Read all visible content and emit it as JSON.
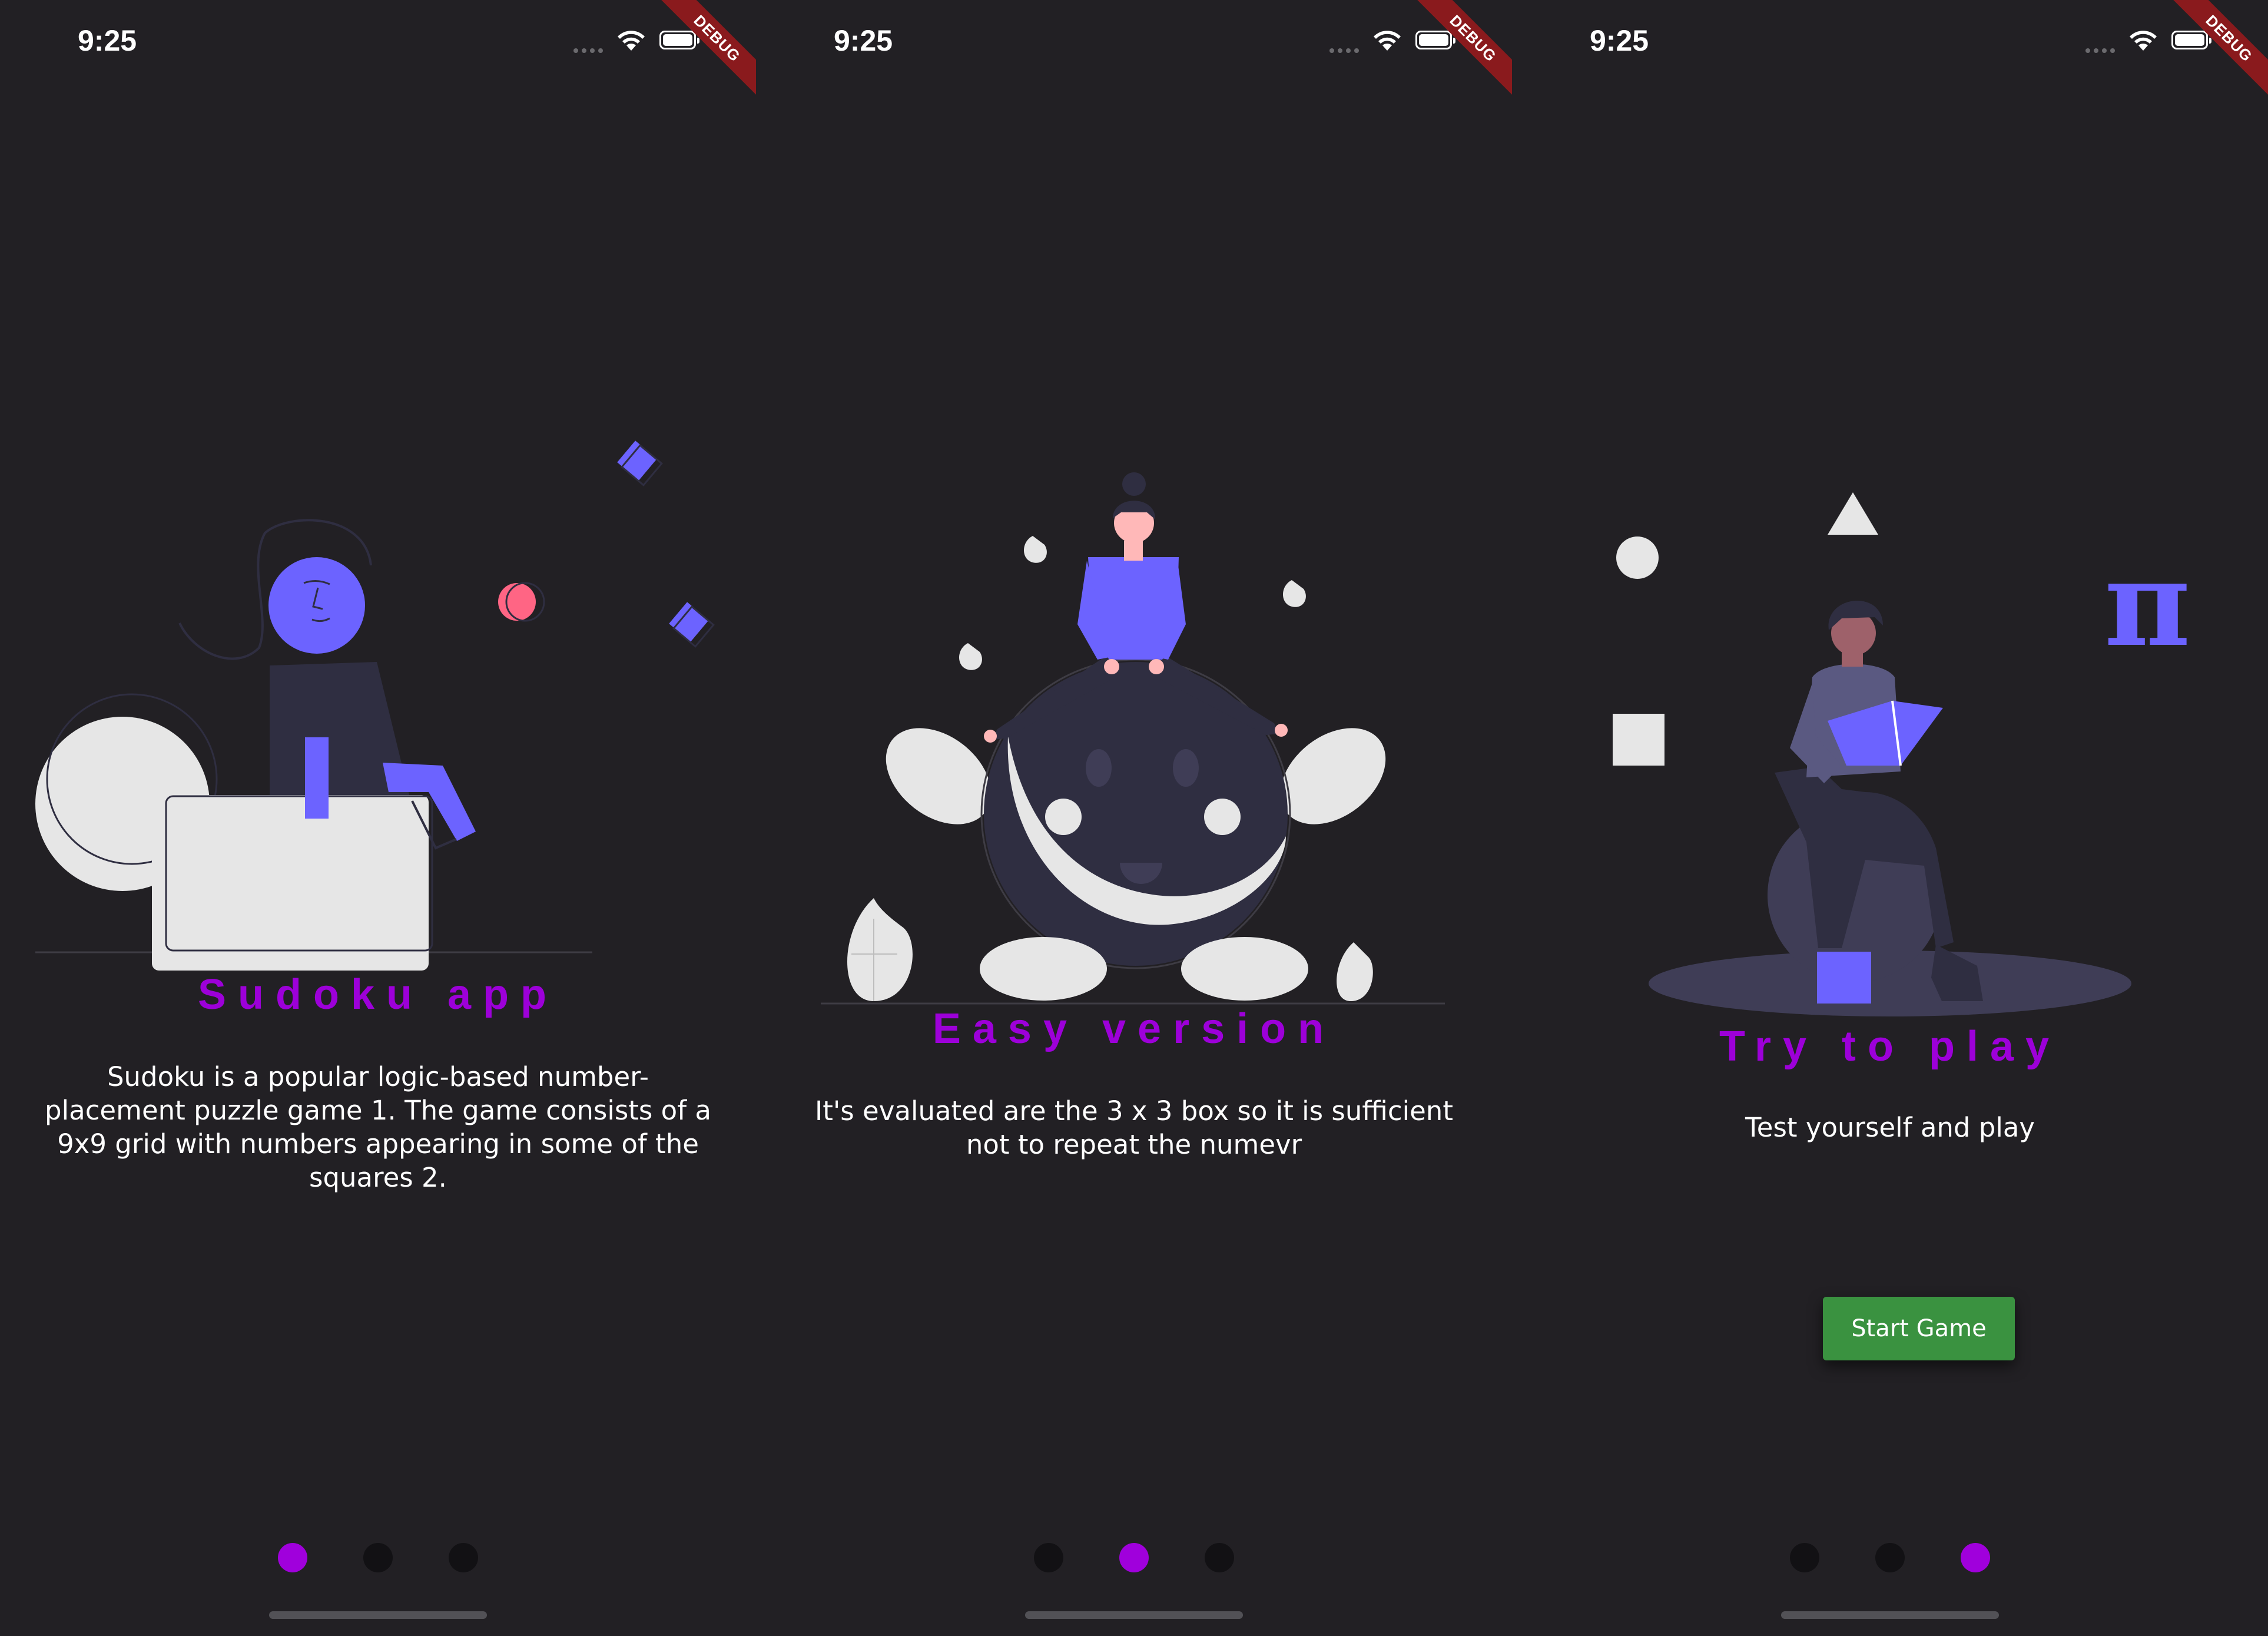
{
  "status_bar": {
    "time": "9:25",
    "debug_label": "DEBUG"
  },
  "slides": [
    {
      "title": "Sudoku app",
      "body": "Sudoku is a popular logic-based number-placement puzzle game 1. The game consists of a 9x9 grid with numbers appearing in some of the squares 2.",
      "active_page": 0
    },
    {
      "title": "Easy version",
      "body": "It's evaluated are the 3 x 3 box so it is sufficient not to repeat the numevr",
      "active_page": 1
    },
    {
      "title": "Try to play",
      "body": "Test yourself and play",
      "button_label": "Start Game",
      "active_page": 2,
      "pi_symbol": "π"
    }
  ],
  "page_count": 3,
  "colors": {
    "background": "#222024",
    "accent_purple": "#9d00d9",
    "illustration_purple": "#6c63ff",
    "button_green": "#3a9240",
    "debug_red": "#8a1a1d"
  },
  "icons": [
    "wifi-icon",
    "battery-icon",
    "signal-dots-icon"
  ]
}
